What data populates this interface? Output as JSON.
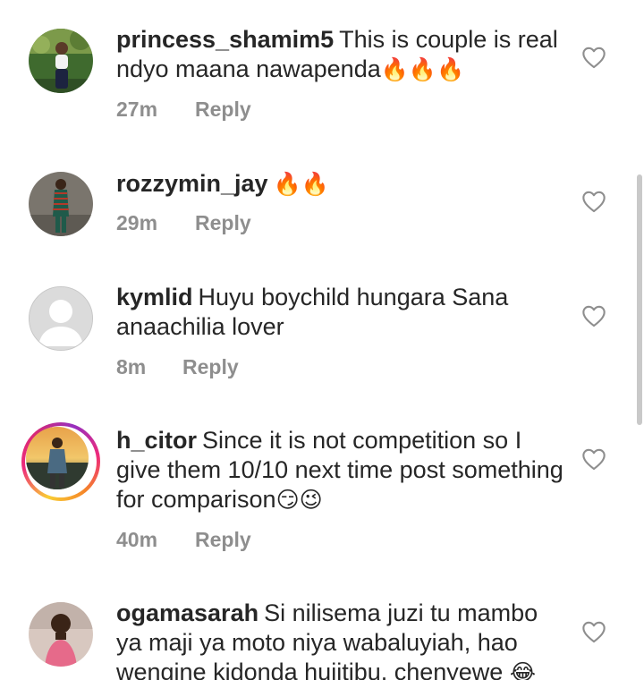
{
  "comments": [
    {
      "username": "princess_shamim5",
      "text": "This is couple is real ndyo maana nawapenda",
      "emoji": "🔥🔥🔥",
      "time": "27m",
      "reply": "Reply"
    },
    {
      "username": "rozzymin_jay",
      "text": "",
      "emoji": "🔥🔥",
      "time": "29m",
      "reply": "Reply"
    },
    {
      "username": "kymlid",
      "text": "Huyu boychild hungara Sana anaachilia lover",
      "emoji": "",
      "time": "8m",
      "reply": "Reply"
    },
    {
      "username": "h_citor",
      "text": "Since it is not competition so I give them 10/10 next time post something for comparison",
      "emoji": "😏😉",
      "time": "40m",
      "reply": "Reply"
    },
    {
      "username": "ogamasarah",
      "text": "Si nilisema juzi tu mambo ya maji ya moto niya wabaluyiah, hao wengine kidonda hujitibu. chenyewe",
      "emoji": "😂",
      "time": "",
      "reply": ""
    }
  ],
  "icons": {
    "like": "heart-outline-icon",
    "default_avatar": "default-profile-icon"
  },
  "colors": {
    "text": "#262626",
    "meta": "#8e8e8e",
    "story_ring": "#ee2a7b"
  }
}
